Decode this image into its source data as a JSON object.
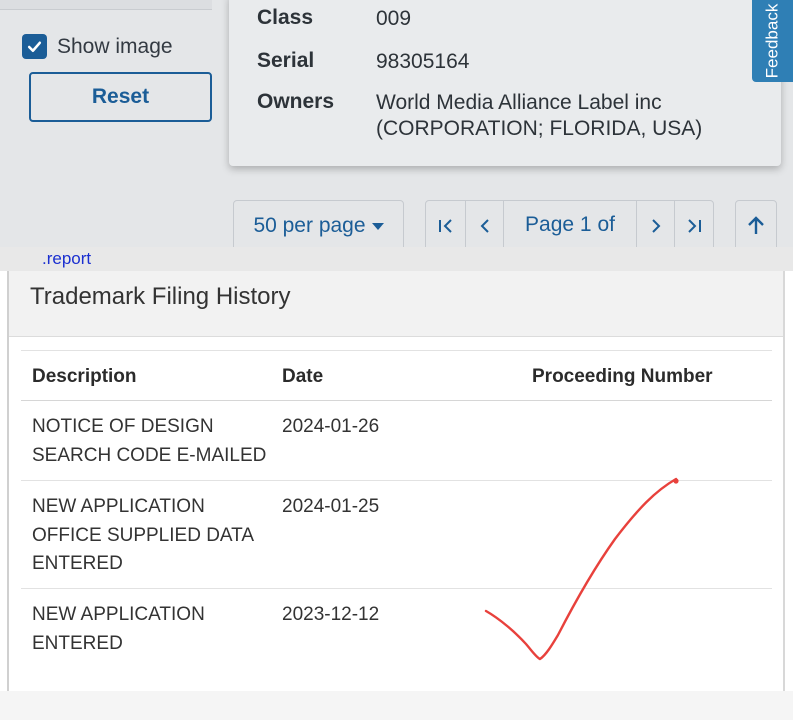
{
  "filters": {
    "show_image_label": "Show image",
    "show_image_checked": true,
    "reset_label": "Reset"
  },
  "result_card": {
    "fields": [
      {
        "label": "Class",
        "value": "009"
      },
      {
        "label": "Serial",
        "value": "98305164"
      },
      {
        "label": "Owners",
        "value_line1": "World Media Alliance Label inc",
        "value_line2": "(CORPORATION; FLORIDA, USA)"
      }
    ]
  },
  "feedback_tab": {
    "label": "Feedback"
  },
  "pagination": {
    "per_page_label": "50 per page",
    "first_icon": "first-page-icon",
    "prev_icon": "chevron-left-icon",
    "page_label": "Page 1 of",
    "next_icon": "chevron-right-icon",
    "last_icon": "last-page-icon",
    "scroll_top_icon": "arrow-up-icon"
  },
  "report": {
    "link_text": ".report"
  },
  "filing_history": {
    "title": "Trademark Filing History",
    "columns": [
      "Description",
      "Date",
      "Proceeding Number"
    ],
    "rows": [
      {
        "description_line1": "NOTICE OF DESIGN",
        "description_line2": "SEARCH CODE E-MAILED",
        "description_line3": "",
        "date": "2024-01-26",
        "proceeding": ""
      },
      {
        "description_line1": "NEW APPLICATION",
        "description_line2": "OFFICE SUPPLIED DATA",
        "description_line3": "ENTERED",
        "date": "2024-01-25",
        "proceeding": ""
      },
      {
        "description_line1": "NEW APPLICATION",
        "description_line2": "ENTERED",
        "description_line3": "",
        "date": "2023-12-12",
        "proceeding": ""
      }
    ]
  },
  "annotation": {
    "icon": "red-checkmark-icon",
    "color": "#e8413c"
  },
  "colors": {
    "accent": "#1b5d97",
    "feedback": "#2f7fb5",
    "link": "#1a2fd0"
  }
}
